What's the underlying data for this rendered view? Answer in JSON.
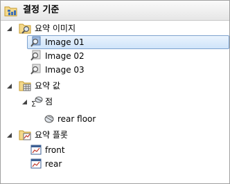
{
  "header": {
    "title": "결정 기준"
  },
  "tree": {
    "summary_images": {
      "label": "요약 이미지",
      "items": [
        "Image 01",
        "Image 02",
        "Image 03"
      ]
    },
    "summary_values": {
      "label": "요약 값",
      "point": {
        "label": "점",
        "items": [
          "rear floor"
        ]
      }
    },
    "summary_plots": {
      "label": "요약 플롯",
      "items": [
        "front",
        "rear"
      ]
    }
  },
  "selected": "Image 01",
  "icons": {
    "header": "decision-tree-icon",
    "folder": "folder-icon",
    "image": "magnifier-image-icon",
    "values": "table-icon",
    "sum": "sigma-icon",
    "probe": "probe-icon",
    "plot": "plot-icon"
  },
  "colors": {
    "selection_border": "#7da2ce",
    "selection_fill": "#cfe4fa"
  }
}
